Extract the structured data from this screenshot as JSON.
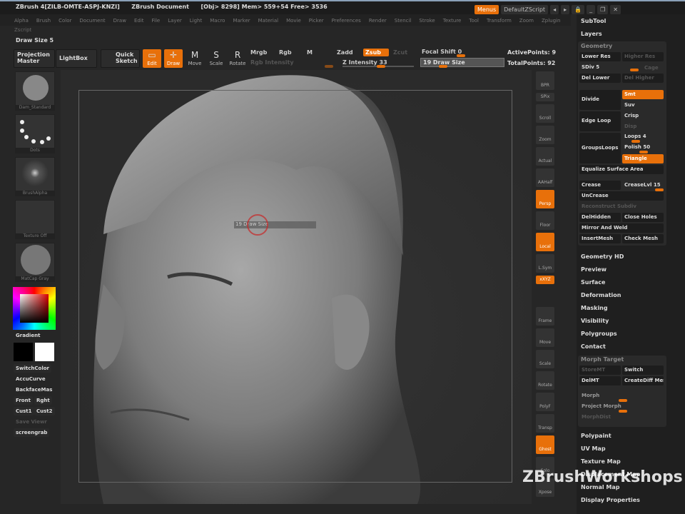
{
  "titlebar": {
    "app": "ZBrush 4[ZILB-OMTE-ASPJ-KNZI]",
    "document": "ZBrush Document",
    "stats": "[Obj> 8298] Mem> 559+54 Free> 3536",
    "menus_btn": "Menus",
    "script_btn": "DefaultZScript"
  },
  "menubar": [
    "Alpha",
    "Brush",
    "Color",
    "Document",
    "Draw",
    "Edit",
    "File",
    "Layer",
    "Light",
    "Macro",
    "Marker",
    "Material",
    "Movie",
    "Picker",
    "Preferences",
    "Render",
    "Stencil",
    "Stroke",
    "Texture",
    "Tool",
    "Transform",
    "Zoom",
    "Zplugin"
  ],
  "zscript": "Zscript",
  "drawsize_label": "Draw Size  5",
  "toolbar": {
    "projection_master": "Projection Master",
    "lightbox": "LightBox",
    "quick_sketch": "Quick Sketch",
    "edit": "Edit",
    "draw": "Draw",
    "move": "Move",
    "scale": "Scale",
    "rotate": "Rotate",
    "mrgb": "Mrgb",
    "rgb": "Rgb",
    "m": "M",
    "rgb_intensity": "Rgb Intensity",
    "zadd": "Zadd",
    "zsub": "Zsub",
    "zcut": "Zcut",
    "z_intensity": "Z Intensity 33",
    "focal_shift": "Focal Shift 0",
    "draw_size": "19 Draw Size",
    "active_points": "ActivePoints: 9",
    "total_points": "TotalPoints: 92"
  },
  "canvas_tooltip": "19 Draw Size",
  "left_shelf": {
    "brush": "Dam_Standard",
    "stroke": "Dots",
    "alpha": "BrushAlpha",
    "texture": "Texture Off",
    "material": "MatCap Gray",
    "gradient": "Gradient",
    "switch_color": "SwitchColor",
    "accucurve": "AccuCurve",
    "backface": "BackfaceMas",
    "front": "Front",
    "right": "Rght",
    "cust1": "Cust1",
    "cust2": "Cust2",
    "save_viewer": "Save Viewr",
    "screengrab": "screengrab"
  },
  "right_shelf": [
    "BPR",
    "SPix",
    "Scroll",
    "Zoom",
    "Actual",
    "AAHalf",
    "Persp",
    "Floor",
    "Local",
    "L.Sym",
    "xXYZ",
    "Frame",
    "Move",
    "Scale",
    "Rotate",
    "PolyF",
    "Transp",
    "Ghost",
    "Solo",
    "Xpose"
  ],
  "tray": {
    "subtool": "SubTool",
    "layers": "Layers",
    "geometry": "Geometry",
    "lower_res": "Lower Res",
    "higher_res": "Higher Res",
    "sdiv": "SDiv 5",
    "cage": "Cage",
    "del_lower": "Del Lower",
    "del_higher": "Del Higher",
    "divide": "Divide",
    "smt": "Smt",
    "suv": "Suv",
    "edge_loop": "Edge Loop",
    "crisp": "Crisp",
    "disp": "Disp",
    "groups_loops": "GroupsLoops",
    "loops": "Loops 4",
    "polish": "Polish 50",
    "triangle": "Triangle",
    "equalize": "Equalize Surface Area",
    "crease": "Crease",
    "crease_lvl": "CreaseLvl 15",
    "uncrease": "UnCrease",
    "reconstruct": "Reconstruct Subdiv",
    "del_hidden": "DelHidden",
    "close_holes": "Close Holes",
    "mirror_weld": "Mirror And Weld",
    "insert_mesh": "InsertMesh",
    "check_mesh": "Check Mesh",
    "sections": [
      "Geometry HD",
      "Preview",
      "Surface",
      "Deformation",
      "Masking",
      "Visibility",
      "Polygroups",
      "Contact"
    ],
    "morph_target": "Morph Target",
    "store_mt": "StoreMT",
    "switch": "Switch",
    "del_mt": "DelMT",
    "create_diff": "CreateDiff Mesh",
    "morph": "Morph",
    "project_morph": "Project Morph",
    "morph_dist": "MorphDist",
    "sections2": [
      "Polypaint",
      "UV Map",
      "Texture Map",
      "Displacement Map",
      "Normal Map",
      "Display Properties"
    ]
  },
  "watermark": "ZBrushWorkshops",
  "colors": {
    "accent": "#e8700a"
  }
}
